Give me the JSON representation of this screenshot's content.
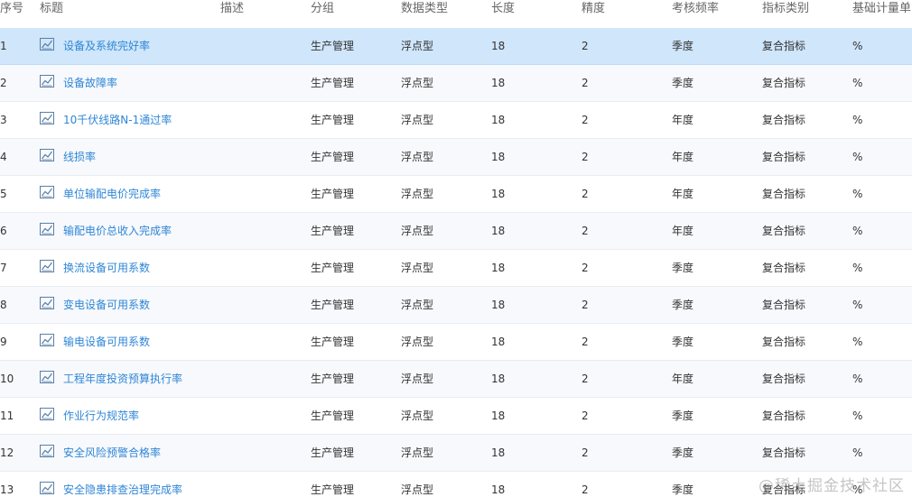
{
  "columns": {
    "index": "序号",
    "title": "标题",
    "description": "描述",
    "group": "分组",
    "data_type": "数据类型",
    "length": "长度",
    "precision": "精度",
    "frequency": "考核频率",
    "category": "指标类别",
    "unit": "基础计量单"
  },
  "rows": [
    {
      "index": "1",
      "title": "设备及系统完好率",
      "group": "生产管理",
      "data_type": "浮点型",
      "length": "18",
      "precision": "2",
      "frequency": "季度",
      "category": "复合指标",
      "unit": "%"
    },
    {
      "index": "2",
      "title": "设备故障率",
      "group": "生产管理",
      "data_type": "浮点型",
      "length": "18",
      "precision": "2",
      "frequency": "季度",
      "category": "复合指标",
      "unit": "%"
    },
    {
      "index": "3",
      "title": "10千伏线路N-1通过率",
      "group": "生产管理",
      "data_type": "浮点型",
      "length": "18",
      "precision": "2",
      "frequency": "年度",
      "category": "复合指标",
      "unit": "%"
    },
    {
      "index": "4",
      "title": "线损率",
      "group": "生产管理",
      "data_type": "浮点型",
      "length": "18",
      "precision": "2",
      "frequency": "年度",
      "category": "复合指标",
      "unit": "%"
    },
    {
      "index": "5",
      "title": "单位输配电价完成率",
      "group": "生产管理",
      "data_type": "浮点型",
      "length": "18",
      "precision": "2",
      "frequency": "年度",
      "category": "复合指标",
      "unit": "%"
    },
    {
      "index": "6",
      "title": "输配电价总收入完成率",
      "group": "生产管理",
      "data_type": "浮点型",
      "length": "18",
      "precision": "2",
      "frequency": "年度",
      "category": "复合指标",
      "unit": "%"
    },
    {
      "index": "7",
      "title": "换流设备可用系数",
      "group": "生产管理",
      "data_type": "浮点型",
      "length": "18",
      "precision": "2",
      "frequency": "季度",
      "category": "复合指标",
      "unit": "%"
    },
    {
      "index": "8",
      "title": "变电设备可用系数",
      "group": "生产管理",
      "data_type": "浮点型",
      "length": "18",
      "precision": "2",
      "frequency": "季度",
      "category": "复合指标",
      "unit": "%"
    },
    {
      "index": "9",
      "title": "输电设备可用系数",
      "group": "生产管理",
      "data_type": "浮点型",
      "length": "18",
      "precision": "2",
      "frequency": "季度",
      "category": "复合指标",
      "unit": "%"
    },
    {
      "index": "10",
      "title": "工程年度投资预算执行率",
      "group": "生产管理",
      "data_type": "浮点型",
      "length": "18",
      "precision": "2",
      "frequency": "年度",
      "category": "复合指标",
      "unit": "%"
    },
    {
      "index": "11",
      "title": "作业行为规范率",
      "group": "生产管理",
      "data_type": "浮点型",
      "length": "18",
      "precision": "2",
      "frequency": "季度",
      "category": "复合指标",
      "unit": "%"
    },
    {
      "index": "12",
      "title": "安全风险预警合格率",
      "group": "生产管理",
      "data_type": "浮点型",
      "length": "18",
      "precision": "2",
      "frequency": "季度",
      "category": "复合指标",
      "unit": "%"
    },
    {
      "index": "13",
      "title": "安全隐患排查治理完成率",
      "group": "生产管理",
      "data_type": "浮点型",
      "length": "18",
      "precision": "2",
      "frequency": "季度",
      "category": "复合指标",
      "unit": "%"
    }
  ],
  "selected_row": 0,
  "row_icon": "line-chart-icon",
  "watermark": "@稀土掘金技术社区",
  "colors": {
    "link": "#2f86d6",
    "selected_row": "#cfe6fb",
    "alt_row": "#f7f9fc"
  }
}
